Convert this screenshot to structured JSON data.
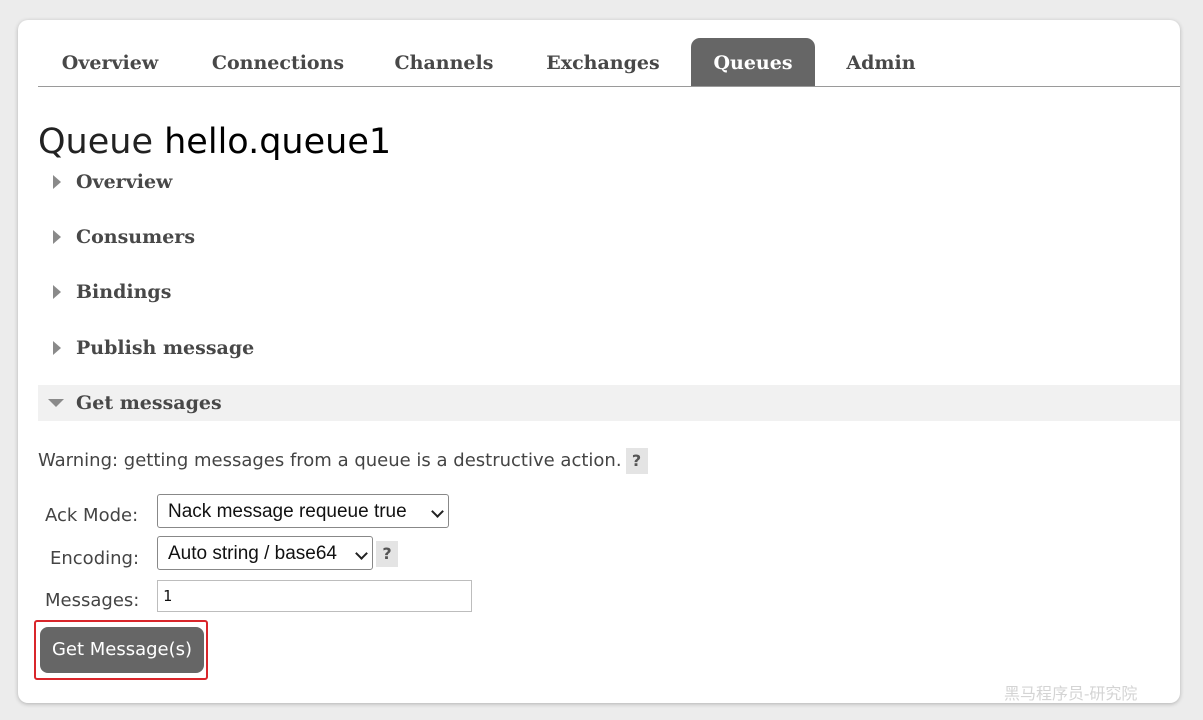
{
  "tabs": [
    {
      "label": "Overview"
    },
    {
      "label": "Connections"
    },
    {
      "label": "Channels"
    },
    {
      "label": "Exchanges"
    },
    {
      "label": "Queues",
      "active": true
    },
    {
      "label": "Admin"
    }
  ],
  "page": {
    "title_prefix": "Queue",
    "queue_name": "hello.queue1"
  },
  "sections": [
    {
      "label": "Overview",
      "expanded": false
    },
    {
      "label": "Consumers",
      "expanded": false
    },
    {
      "label": "Bindings",
      "expanded": false
    },
    {
      "label": "Publish message",
      "expanded": false
    },
    {
      "label": "Get messages",
      "expanded": true
    }
  ],
  "get_messages": {
    "warning": "Warning: getting messages from a queue is a destructive action.",
    "help_symbol": "?",
    "ack_mode_label": "Ack Mode:",
    "ack_mode_value": "Nack message requeue true",
    "encoding_label": "Encoding:",
    "encoding_value": "Auto string / base64",
    "messages_label": "Messages:",
    "messages_value": "1",
    "button_label": "Get Message(s)"
  },
  "watermark": "黑马程序员-研究院",
  "colors": {
    "tab_active_bg": "#666666",
    "button_bg": "#666666",
    "highlight_border": "#d9262b"
  },
  "icons": {
    "collapsed": "triangle-right-icon",
    "expanded": "triangle-down-icon",
    "dropdown": "chevron-down-icon",
    "help": "help-icon"
  }
}
